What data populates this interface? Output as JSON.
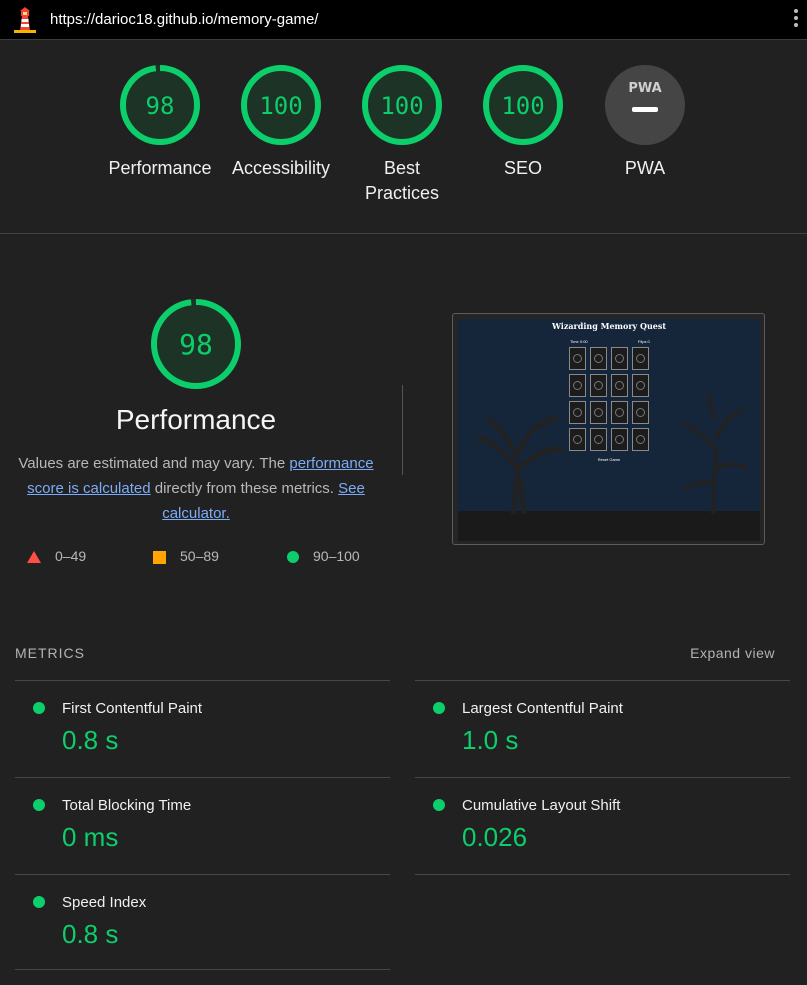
{
  "url": "https://darioc18.github.io/memory-game/",
  "colors": {
    "pass": "#0cce6b",
    "average": "#ffa400",
    "fail": "#ff4e42",
    "na": "#454545"
  },
  "scores": [
    {
      "value": "98",
      "fraction": 0.98,
      "label": "Performance"
    },
    {
      "value": "100",
      "fraction": 1.0,
      "label": "Accessibility"
    },
    {
      "value": "100",
      "fraction": 1.0,
      "label": "Best Practices"
    },
    {
      "value": "100",
      "fraction": 1.0,
      "label": "SEO"
    },
    {
      "value": "",
      "fraction": 0,
      "label": "PWA",
      "badge": "PWA"
    }
  ],
  "performance": {
    "score": "98",
    "title": "Performance",
    "desc_start": "Values are estimated and may vary. The ",
    "link1": "performance score is calculated",
    "desc_mid": " directly from these metrics. ",
    "link2": "See calculator."
  },
  "legend": [
    {
      "shape": "triangle",
      "range": "0–49"
    },
    {
      "shape": "square",
      "range": "50–89"
    },
    {
      "shape": "circle",
      "range": "90–100"
    }
  ],
  "thumbnail": {
    "title": "Wizarding Memory Quest",
    "time": "Time 0:00",
    "flips": "Flips 0",
    "reset": "Reset Game"
  },
  "metrics": {
    "heading": "METRICS",
    "expand": "Expand view",
    "items": [
      {
        "name": "First Contentful Paint",
        "value": "0.8 s"
      },
      {
        "name": "Largest Contentful Paint",
        "value": "1.0 s"
      },
      {
        "name": "Total Blocking Time",
        "value": "0 ms"
      },
      {
        "name": "Cumulative Layout Shift",
        "value": "0.026"
      },
      {
        "name": "Speed Index",
        "value": "0.8 s"
      }
    ]
  }
}
